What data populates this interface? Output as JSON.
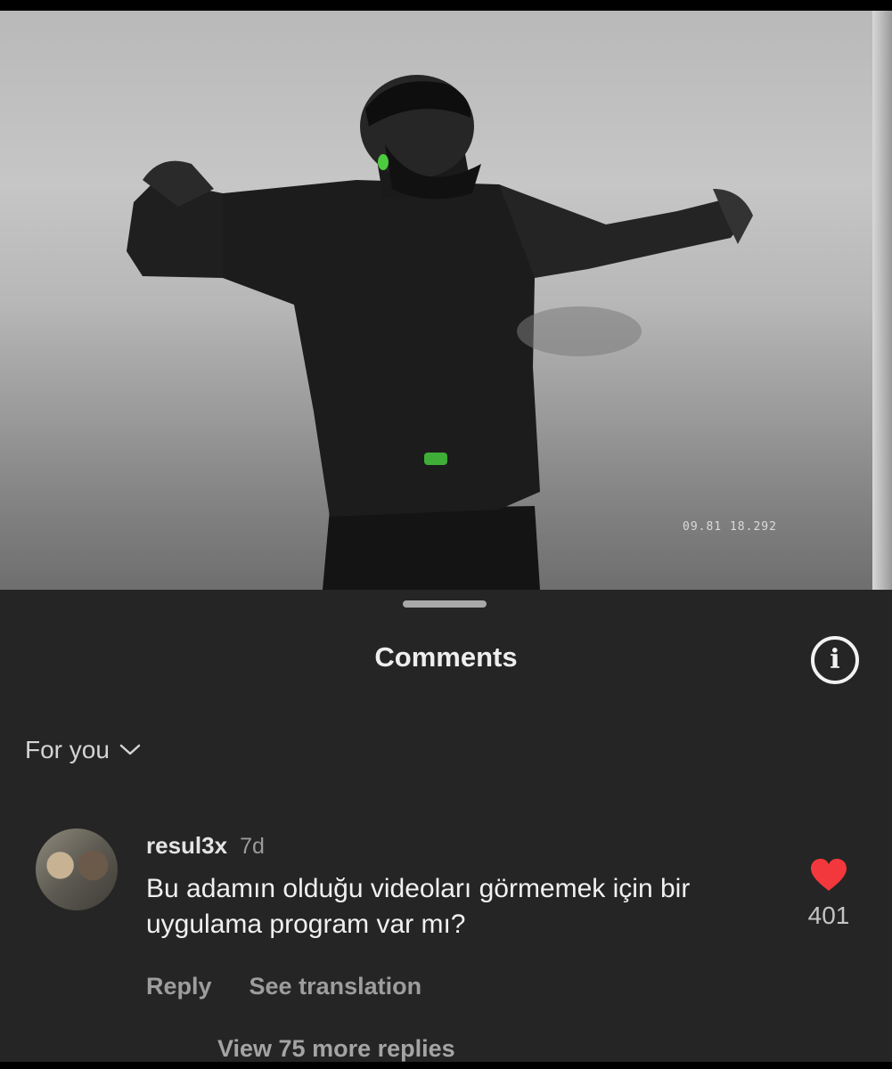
{
  "video": {
    "overlay_timestamp": "09.81 18.292"
  },
  "comments_sheet": {
    "title": "Comments",
    "info_icon": "info-circle-icon",
    "filter": {
      "label": "For you",
      "icon": "chevron-down-icon"
    },
    "comments": [
      {
        "username": "resul3x",
        "age": "7d",
        "text": "Bu adamın olduğu videoları görmemek için bir uygulama program var mı?",
        "like_icon": "heart-icon",
        "like_color": "#f2383d",
        "like_count": "401",
        "reply_label": "Reply",
        "translate_label": "See translation",
        "view_replies_label": "View 75 more replies"
      }
    ]
  },
  "colors": {
    "sheet_background": "#252525",
    "text_primary": "#f0f0f0",
    "text_secondary": "#9d9d9d",
    "heart": "#f2383d"
  }
}
